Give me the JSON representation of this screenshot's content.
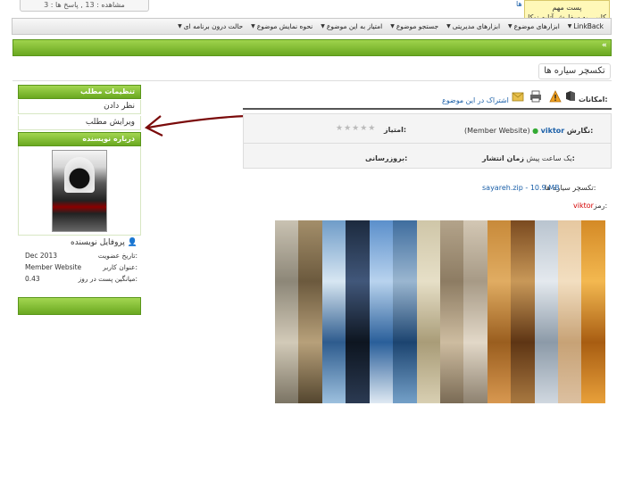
{
  "top": {
    "views_replies": "مشاهده : 13 , پاسخ ها : 3",
    "top_link": "ها",
    "tooltip_line1": "پست مهم",
    "tooltip_line2": "کلیپی به سفارش آتلیه نوکا"
  },
  "menu": {
    "items": [
      {
        "label": "LinkBack"
      },
      {
        "label": "ابزارهای موضوع"
      },
      {
        "label": "ابزارهای مدیریتی"
      },
      {
        "label": "جستجو موضوع"
      },
      {
        "label": "امتیاز به این موضوع"
      },
      {
        "label": "نحوه نمایش موضوع"
      },
      {
        "label": "حالت درون برنامه ای"
      }
    ]
  },
  "header": {
    "nav_icon": "«"
  },
  "thread": {
    "title": "تکسچر سیاره ها"
  },
  "sidebar": {
    "settings_title": "تنظیمات مطلب",
    "comment": "نظر دادن",
    "edit": "ویرایش مطلب",
    "about_title": "درباره نویسنده",
    "profile": "پروفایل نویسنده",
    "join_key": "تاریخ عضویت:",
    "join_val": "Dec 2013",
    "title_key": "عنوان کاربر:",
    "title_val": "Member Website",
    "avg_key": "میانگین پست در روز:",
    "avg_val": "0.43"
  },
  "tools": {
    "label": "امکانات:",
    "share": "اشتراک در این موضوع",
    "icons": [
      "bookmark-icon",
      "warning-icon",
      "print-icon",
      "email-icon"
    ]
  },
  "post": {
    "author_key": "نگارش:",
    "author_name": "viktor",
    "author_title": "(Member Website)",
    "rating_label": "امتیاز:",
    "stars": "★★★★★",
    "rating": 0,
    "date_key": "زمان انتشار:",
    "date_val": "یک ساعت پیش",
    "update_label": "بروزرسانی:"
  },
  "content": {
    "title": "تکسچر سیاره ها:",
    "file_link": "sayareh.zip - 10.9 MB",
    "password_key": "رمز:",
    "password_val": "viktor"
  },
  "colors": {
    "green_light": "#a3d651",
    "green_dark": "#6aa820",
    "link": "#1a5fa8",
    "password_red": "#d40000",
    "arrow": "#7a0a0a"
  }
}
